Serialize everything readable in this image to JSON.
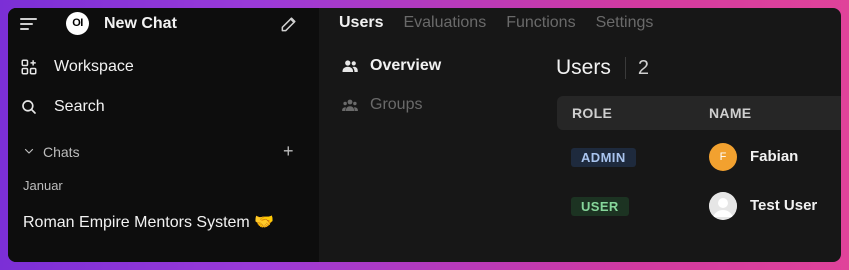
{
  "sidebar": {
    "logo_text": "OI",
    "new_chat_label": "New Chat",
    "workspace_label": "Workspace",
    "search_label": "Search",
    "chats_label": "Chats",
    "add_label": "+",
    "group_label": "Januar",
    "chat_items": [
      {
        "title": "Roman Empire Mentors System 🤝"
      }
    ]
  },
  "tabs": [
    {
      "label": "Users",
      "active": true
    },
    {
      "label": "Evaluations",
      "active": false
    },
    {
      "label": "Functions",
      "active": false
    },
    {
      "label": "Settings",
      "active": false
    }
  ],
  "subnav": [
    {
      "label": "Overview",
      "active": true
    },
    {
      "label": "Groups",
      "active": false
    }
  ],
  "users": {
    "title": "Users",
    "count": "2",
    "columns": {
      "role": "ROLE",
      "name": "NAME"
    },
    "rows": [
      {
        "role": "ADMIN",
        "name": "Fabian",
        "avatar_initial": "F",
        "avatar_color": "#f2a12f"
      },
      {
        "role": "USER",
        "name": "Test User",
        "avatar_initial": "",
        "avatar_color": "#e6e6e6"
      }
    ]
  },
  "colors": {
    "sidebar_bg": "#0d0d0d",
    "main_bg": "#171717",
    "admin_badge_bg": "#1e2a3d",
    "admin_badge_text": "#a9c4ee",
    "user_badge_bg": "#1c3322",
    "user_badge_text": "#86d69a"
  }
}
